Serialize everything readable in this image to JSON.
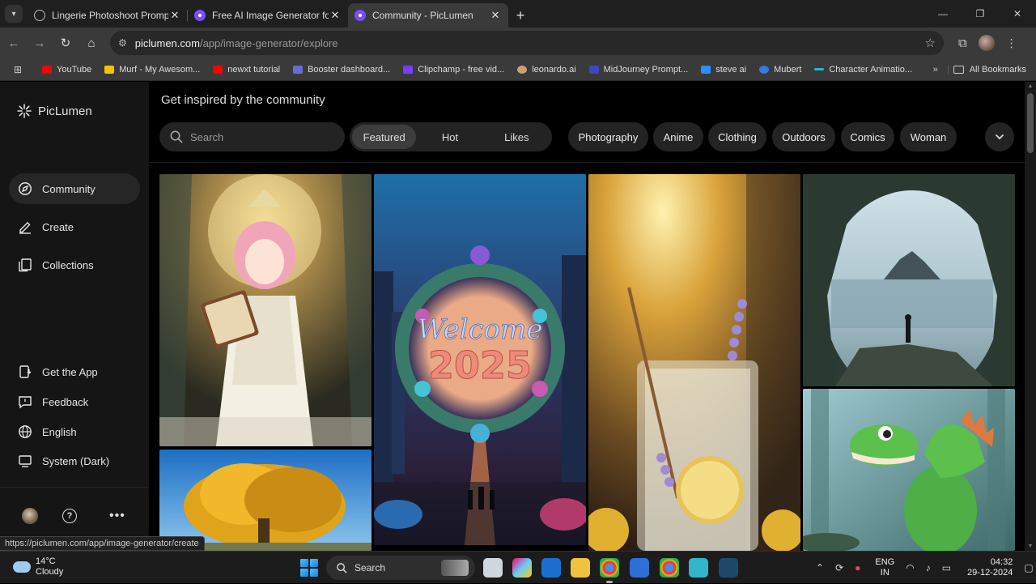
{
  "browser": {
    "tabs": [
      {
        "title": "Lingerie Photoshoot Prompts",
        "favicon": "globe-icon",
        "active": false
      },
      {
        "title": "Free AI Image Generator for AI",
        "favicon": "piclumen-icon",
        "active": false
      },
      {
        "title": "Community - PicLumen",
        "favicon": "piclumen-icon",
        "active": true
      }
    ],
    "url_host": "piclumen.com",
    "url_path": "/app/image-generator/explore",
    "bookmarks": [
      {
        "label": "YouTube",
        "color": "#ff0000"
      },
      {
        "label": "Murf - My Awesom...",
        "color": "#f5c400"
      },
      {
        "label": "newxt tutorial",
        "color": "#ff0000"
      },
      {
        "label": "Booster dashboard...",
        "color": "#6b6bd6"
      },
      {
        "label": "Clipchamp - free vid...",
        "color": "#7a3cff"
      },
      {
        "label": "leonardo.ai",
        "color": "#c9a27a"
      },
      {
        "label": "MidJourney Prompt...",
        "color": "#3a4ab8"
      },
      {
        "label": "steve ai",
        "color": "#2b8fff"
      },
      {
        "label": "Mubert",
        "color": "#2f7de1"
      },
      {
        "label": "Character Animatio...",
        "color": "#2ab3d6"
      }
    ],
    "all_bookmarks": "All Bookmarks"
  },
  "app": {
    "brand": "PicLumen",
    "nav": [
      {
        "label": "Community",
        "icon": "compass-icon",
        "active": true
      },
      {
        "label": "Create",
        "icon": "pen-icon",
        "active": false
      },
      {
        "label": "Collections",
        "icon": "collections-icon",
        "active": false
      }
    ],
    "nav_bottom": [
      {
        "label": "Get the App",
        "icon": "get-app-icon"
      },
      {
        "label": "Feedback",
        "icon": "feedback-icon"
      },
      {
        "label": "English",
        "icon": "globe-icon"
      },
      {
        "label": "System (Dark)",
        "icon": "monitor-icon"
      }
    ]
  },
  "explore": {
    "heading": "Get inspired by the community",
    "search_placeholder": "Search",
    "sort_tabs": [
      "Featured",
      "Hot",
      "Likes"
    ],
    "active_sort": "Featured",
    "categories": [
      "Photography",
      "Anime",
      "Clothing",
      "Outdoors",
      "Comics",
      "Woman"
    ],
    "images": [
      {
        "subject": "anime-girl-with-book"
      },
      {
        "subject": "welcome-2025-wreath",
        "caption_top": "Welcome",
        "caption_bottom": "2025"
      },
      {
        "subject": "lavender-lemonade"
      },
      {
        "subject": "cave-sea-view"
      },
      {
        "subject": "golden-tree"
      },
      {
        "subject": "green-dinosaur"
      }
    ]
  },
  "status_url": "https://piclumen.com/app/image-generator/create",
  "taskbar": {
    "temperature": "14°C",
    "condition": "Cloudy",
    "search_label": "Search",
    "lang_top": "ENG",
    "lang_bottom": "IN",
    "time": "04:32",
    "date": "29-12-2024"
  }
}
